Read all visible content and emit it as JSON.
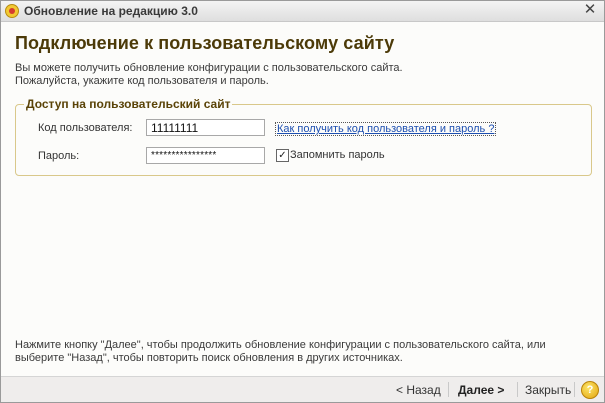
{
  "window": {
    "title": "Обновление на редакцию 3.0",
    "close_glyph": "✕",
    "app_icon": "1c-logo-icon"
  },
  "heading": "Подключение к пользовательскому сайту",
  "intro": {
    "line1": "Вы можете получить обновление конфигурации с пользовательского сайта.",
    "line2": "Пожалуйста,  укажите код пользователя и пароль."
  },
  "group": {
    "title": "Доступ на пользовательский сайт",
    "user_label": "Код пользователя:",
    "user_value": "11111111",
    "password_label": "Пароль:",
    "password_value": "****************",
    "help_link": "Как получить код пользователя и пароль ?",
    "remember_label": "Запомнить пароль",
    "remember_checked": true
  },
  "bottom": {
    "line1": "Нажмите кнопку \"Далее\", чтобы продолжить обновление конфигурации с пользовательского сайта, или",
    "line2": "выберите \"Назад\", чтобы повторить поиск обновления в других источниках."
  },
  "footer": {
    "back": "< Назад",
    "next": "Далее >",
    "close": "Закрыть",
    "help": "?"
  },
  "colors": {
    "heading": "#4c3a08",
    "group_border": "#d9c88a",
    "link": "#1d4fb0"
  }
}
